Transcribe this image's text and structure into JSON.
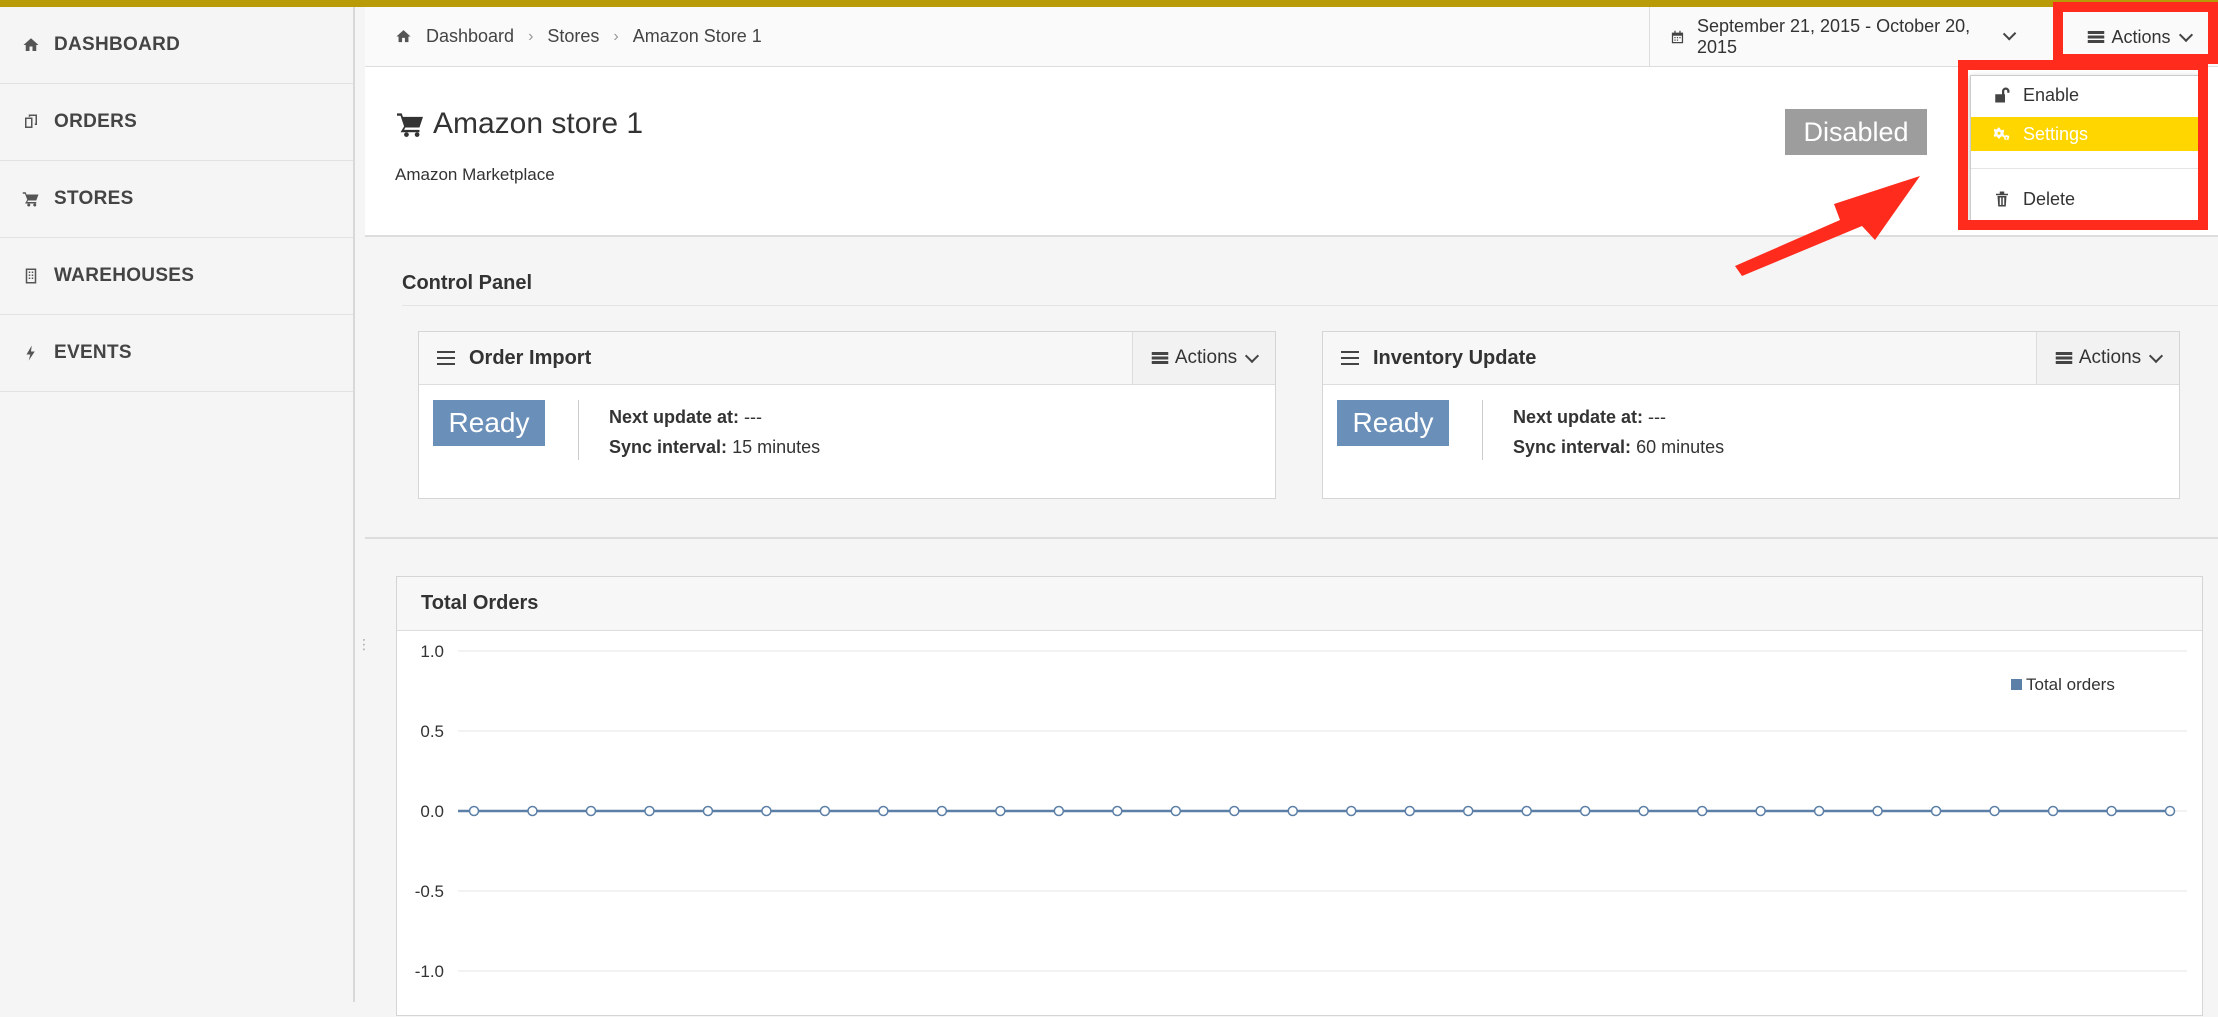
{
  "sidebar": {
    "items": [
      {
        "label": "DASHBOARD",
        "icon": "home-icon"
      },
      {
        "label": "ORDERS",
        "icon": "orders-icon"
      },
      {
        "label": "STORES",
        "icon": "cart-icon"
      },
      {
        "label": "WAREHOUSES",
        "icon": "building-icon"
      },
      {
        "label": "EVENTS",
        "icon": "bolt-icon"
      }
    ]
  },
  "breadcrumb": [
    "Dashboard",
    "Stores",
    "Amazon Store 1"
  ],
  "header": {
    "date_range": "September 21, 2015 - October 20, 2015",
    "actions_label": "Actions"
  },
  "store": {
    "title": "Amazon store 1",
    "subtitle": "Amazon Marketplace",
    "status": "Disabled"
  },
  "actions_menu": {
    "items": [
      {
        "label": "Enable",
        "icon": "unlock-icon"
      },
      {
        "label": "Settings",
        "icon": "gears-icon"
      },
      {
        "label": "Delete",
        "icon": "trash-icon"
      }
    ]
  },
  "control_panel": {
    "title": "Control Panel",
    "panels": [
      {
        "title": "Order Import",
        "actions_label": "Actions",
        "status": "Ready",
        "next_update_label": "Next update at:",
        "next_update_value": "---",
        "sync_interval_label": "Sync interval:",
        "sync_interval_value": "15 minutes"
      },
      {
        "title": "Inventory Update",
        "actions_label": "Actions",
        "status": "Ready",
        "next_update_label": "Next update at:",
        "next_update_value": "---",
        "sync_interval_label": "Sync interval:",
        "sync_interval_value": "60 minutes"
      }
    ]
  },
  "colors": {
    "accent_bar": "#b89b06",
    "ready_badge": "#6a8fb8",
    "disabled_badge": "#9d9d9d",
    "menu_highlight": "#ffd600",
    "annotation": "#ff2b1c",
    "series": "#5b7fa6"
  },
  "chart_data": {
    "type": "line",
    "title": "Total Orders",
    "series": [
      {
        "name": "Total orders",
        "values": [
          0,
          0,
          0,
          0,
          0,
          0,
          0,
          0,
          0,
          0,
          0,
          0,
          0,
          0,
          0,
          0,
          0,
          0,
          0,
          0,
          0,
          0,
          0,
          0,
          0,
          0,
          0,
          0,
          0,
          0
        ]
      }
    ],
    "y_ticks": [
      "1.0",
      "0.5",
      "0.0",
      "-0.5",
      "-1.0"
    ],
    "ylim": [
      -1.0,
      1.0
    ],
    "grid": true,
    "legend_position": "top-right"
  }
}
